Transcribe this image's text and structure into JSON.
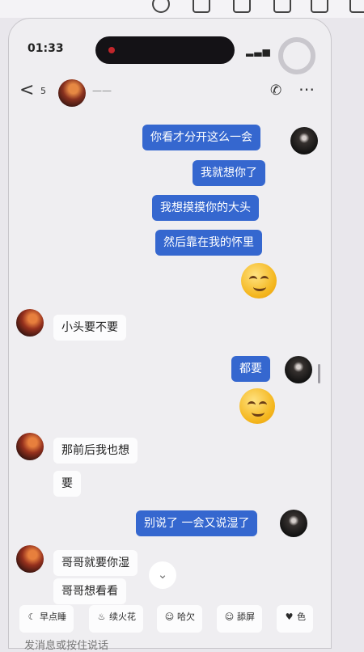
{
  "status": {
    "time": "01:33"
  },
  "header": {
    "back_glyph": "<",
    "unread_count": "5",
    "contact_name": "——"
  },
  "messages": [
    {
      "side": "out",
      "text": "你看才分开这么一会"
    },
    {
      "side": "out",
      "text": "我就想你了"
    },
    {
      "side": "out",
      "text": "我想摸摸你的大头"
    },
    {
      "side": "out",
      "text": "然后靠在我的怀里"
    },
    {
      "side": "in",
      "text": "小头要不要"
    },
    {
      "side": "out",
      "text": "都要"
    },
    {
      "side": "in",
      "text": "那前后我也想"
    },
    {
      "side": "in",
      "text": "要"
    },
    {
      "side": "out",
      "text": "别说了 一会又说湿了"
    },
    {
      "side": "in",
      "text": "哥哥就要你湿"
    },
    {
      "side": "in",
      "text": "哥哥想看看"
    }
  ],
  "quick_replies": [
    {
      "label": "早点睡",
      "icon": "moon-icon"
    },
    {
      "label": "续火花",
      "icon": "flame-icon"
    },
    {
      "label": "哈欠",
      "icon": "yawn-face-icon"
    },
    {
      "label": "舔屏",
      "icon": "tongue-face-icon"
    },
    {
      "label": "色",
      "icon": "heart-eyes-icon"
    }
  ],
  "input": {
    "placeholder": "发消息或按住说话"
  },
  "colors": {
    "outgoing_bubble": "#3567cf",
    "incoming_bubble": "#fcfcfd",
    "screen_bg": "#efeef1"
  }
}
